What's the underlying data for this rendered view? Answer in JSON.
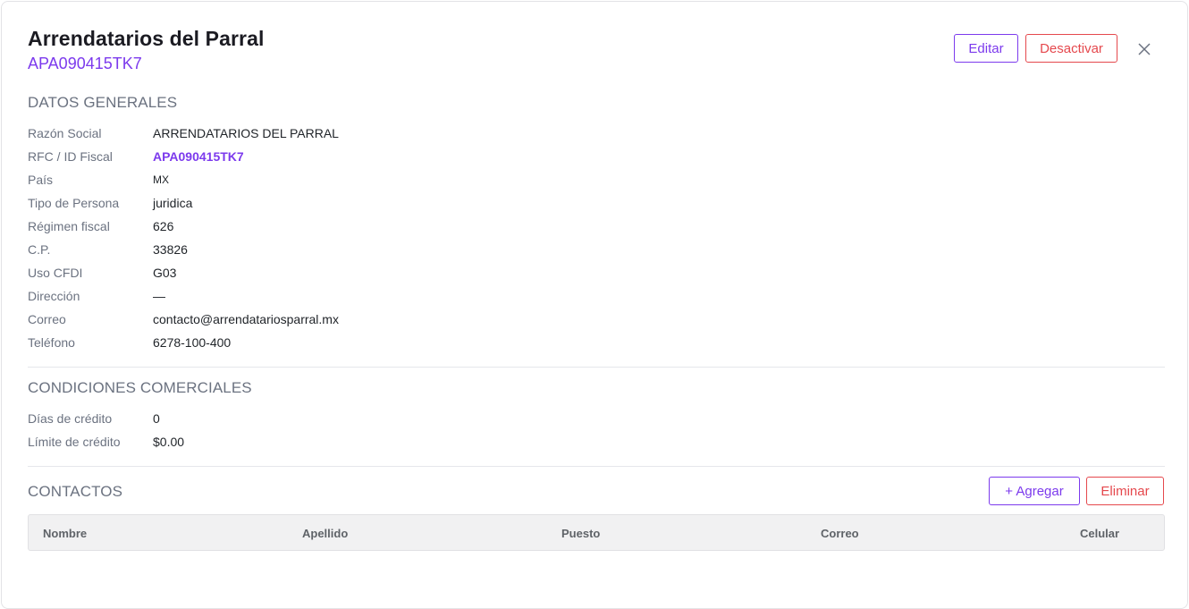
{
  "header": {
    "title": "Arrendatarios del Parral",
    "subtitle": "APA090415TK7",
    "edit_label": "Editar",
    "deactivate_label": "Desactivar",
    "close_icon": "close-icon"
  },
  "general": {
    "section_title": "DATOS GENERALES",
    "fields": [
      {
        "label": "Razón Social",
        "value": "ARRENDATARIOS DEL PARRAL"
      },
      {
        "label": "RFC / ID Fiscal",
        "value": "APA090415TK7"
      },
      {
        "label": "País",
        "value": "MX"
      },
      {
        "label": "Tipo de Persona",
        "value": "juridica"
      },
      {
        "label": "Régimen fiscal",
        "value": "626"
      },
      {
        "label": "C.P.",
        "value": "33826"
      },
      {
        "label": "Uso CFDI",
        "value": "G03"
      },
      {
        "label": "Dirección",
        "value": "—"
      },
      {
        "label": "Correo",
        "value": "contacto@arrendatariosparral.mx"
      },
      {
        "label": "Teléfono",
        "value": "6278-100-400"
      }
    ]
  },
  "commercial": {
    "section_title": "CONDICIONES COMERCIALES",
    "fields": [
      {
        "label": "Días de crédito",
        "value": "0"
      },
      {
        "label": "Límite de crédito",
        "value": "$0.00"
      }
    ]
  },
  "contacts": {
    "section_title": "CONTACTOS",
    "add_label": "+ Agregar",
    "delete_label": "Eliminar",
    "columns": [
      "Nombre",
      "Apellido",
      "Puesto",
      "Correo",
      "Celular"
    ]
  },
  "colors": {
    "accent": "#7c3aed",
    "danger": "#e5484d",
    "muted_text": "#6b7280"
  }
}
